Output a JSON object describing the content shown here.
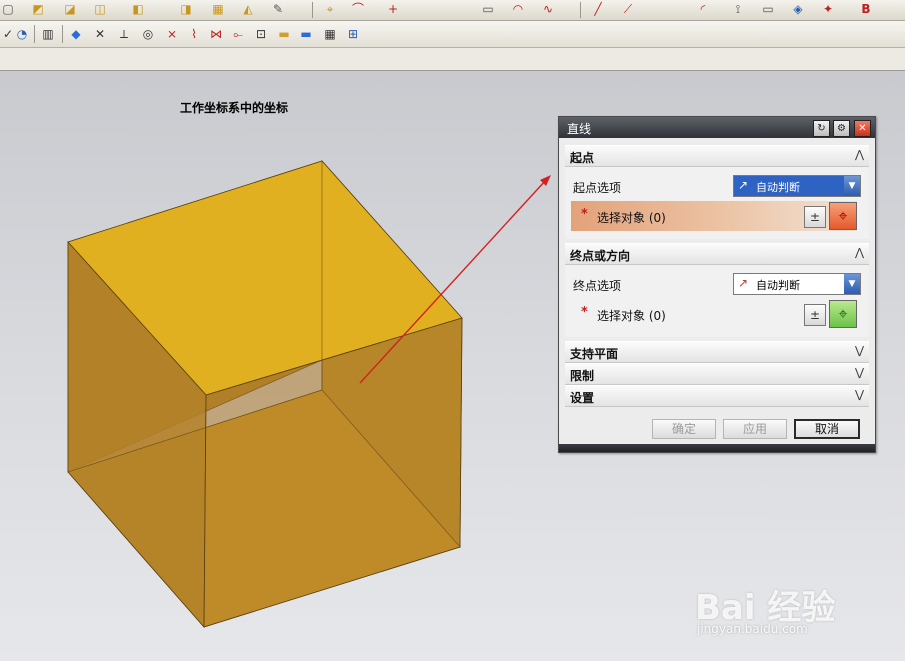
{
  "window": {
    "status_title": "工作坐标系中的坐标"
  },
  "dialog": {
    "title": "直线",
    "title_buttons": {
      "reset_glyph": "↻",
      "settings_glyph": "⚙",
      "close_glyph": "✕"
    },
    "sections": {
      "start": {
        "label": "起点",
        "collapse_glyph": "⋀",
        "option_label": "起点选项",
        "option_value": "自动判断",
        "select_label": "选择对象 (0)",
        "required_mark": "*"
      },
      "end": {
        "label": "终点或方向",
        "collapse_glyph": "⋀",
        "option_label": "终点选项",
        "option_value": "自动判断",
        "select_label": "选择对象 (0)",
        "required_mark": "*"
      },
      "support_plane": {
        "label": "支持平面",
        "expand_glyph": "⋁"
      },
      "limits": {
        "label": "限制",
        "expand_glyph": "⋁"
      },
      "settings": {
        "label": "设置",
        "expand_glyph": "⋁"
      }
    },
    "buttons": {
      "ok": "确定",
      "apply": "应用",
      "cancel": "取消"
    }
  },
  "watermark": {
    "brand": "Bai 经验",
    "url": "jingyan.baidu.com"
  },
  "colors": {
    "cube_top": "#e1b020",
    "cube_front": "#b8862b",
    "cube_bottom": "#d9a52b",
    "line": "#d42020",
    "active_row": "#e3a27a"
  }
}
